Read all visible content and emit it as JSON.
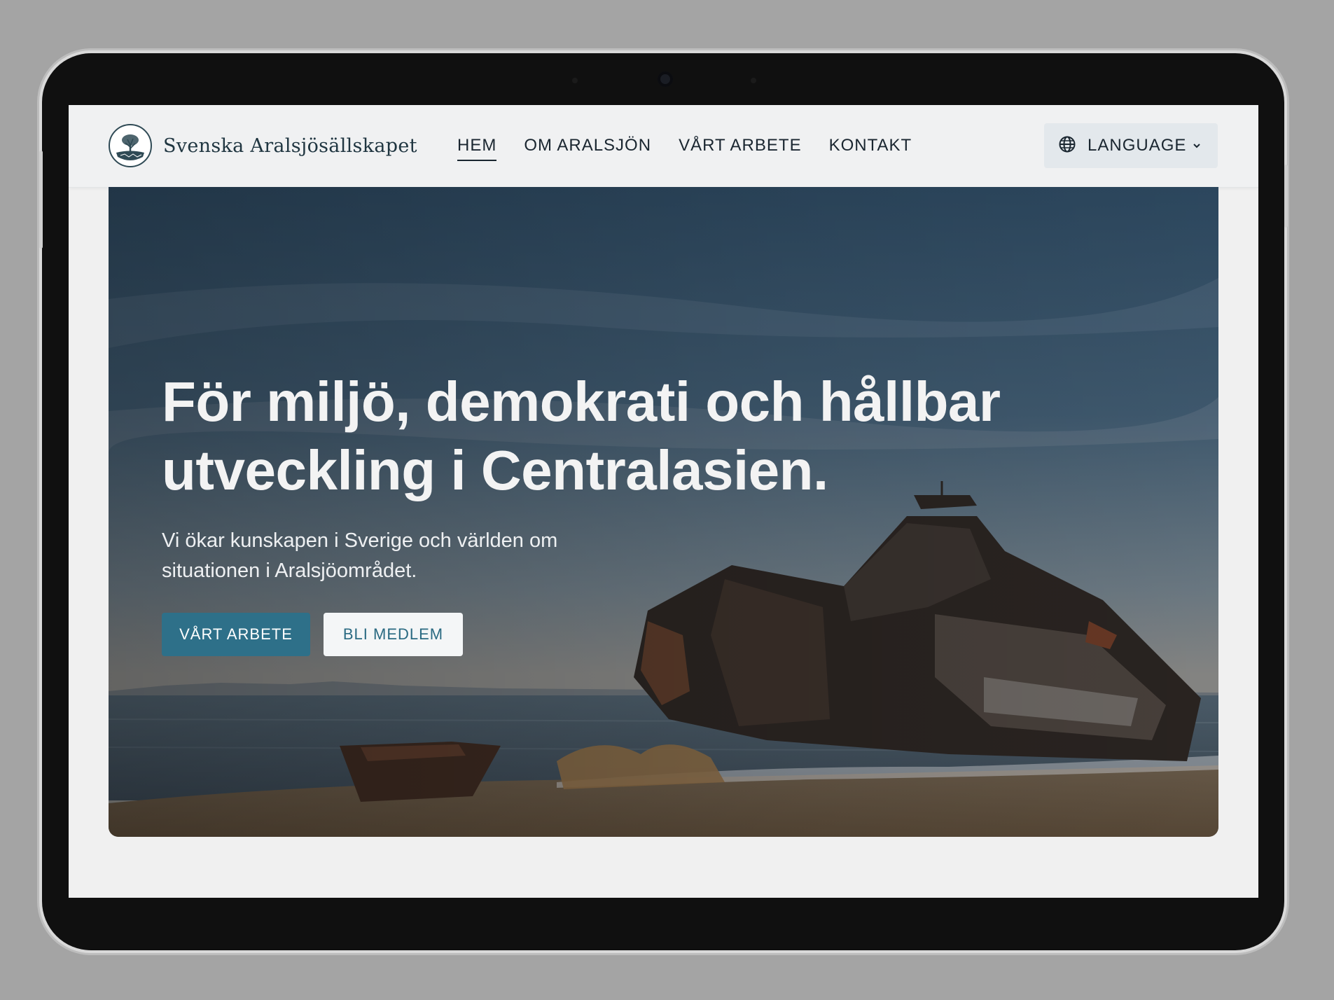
{
  "site": {
    "name": "Svenska Aralsjösällskapet",
    "logo_icon": "tree-globe-icon"
  },
  "nav": {
    "items": [
      {
        "label": "HEM",
        "active": true
      },
      {
        "label": "OM ARALSJÖN",
        "active": false
      },
      {
        "label": "VÅRT ARBETE",
        "active": false
      },
      {
        "label": "KONTAKT",
        "active": false
      }
    ]
  },
  "language": {
    "label": "LANGUAGE",
    "icon": "globe-icon",
    "caret_icon": "chevron-down-icon"
  },
  "hero": {
    "title": "För miljö, demokrati och hållbar utveckling i Centralasien.",
    "subtitle": "Vi ökar kunskapen i Sverige och världen om situationen i Aralsjöområdet.",
    "primary_button": "VÅRT ARBETE",
    "secondary_button": "BLI MEDLEM",
    "image_subject": "shipwreck-on-shore"
  },
  "colors": {
    "accent": "#2e7089",
    "header_bg": "#f0f1f2",
    "text_dark": "#1a2630"
  }
}
